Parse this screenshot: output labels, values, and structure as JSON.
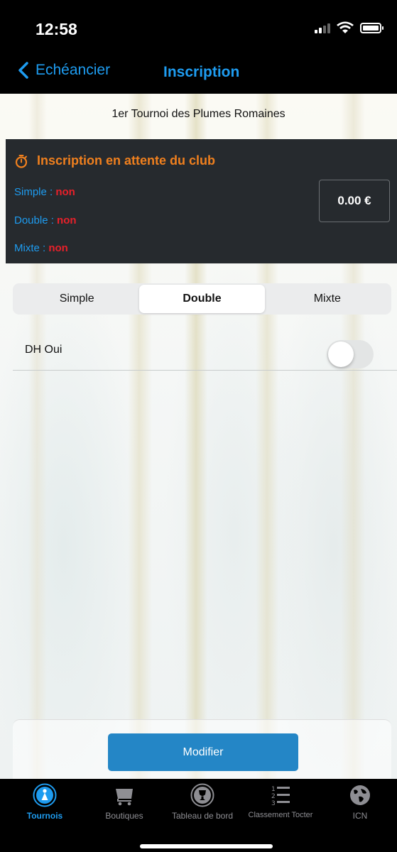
{
  "status_bar": {
    "time": "12:58"
  },
  "nav": {
    "back_label": "Echéancier",
    "title": "Inscription"
  },
  "tournament": {
    "title": "1er Tournoi des Plumes Romaines"
  },
  "registration": {
    "status": "Inscription en attente  du club",
    "simple_label": "Simple : ",
    "simple_value": "non",
    "double_label": "Double : ",
    "double_value": "non",
    "mixte_label": "Mixte : ",
    "mixte_value": "non",
    "price": "0.00 €"
  },
  "segments": {
    "simple": "Simple",
    "double": "Double",
    "mixte": "Mixte",
    "selected": "Double"
  },
  "dh_row": {
    "label": "DH Oui",
    "toggle_on": false
  },
  "actions": {
    "modify_label": "Modifier"
  },
  "tabs": {
    "tournois": "Tournois",
    "boutiques": "Boutiques",
    "tableau": "Tableau de bord",
    "classement": "Classement Tocter",
    "icn": "ICN"
  },
  "colors": {
    "accent": "#1e9cf0",
    "warning": "#f0801e",
    "negative": "#e8202a",
    "button": "#2486c6"
  }
}
